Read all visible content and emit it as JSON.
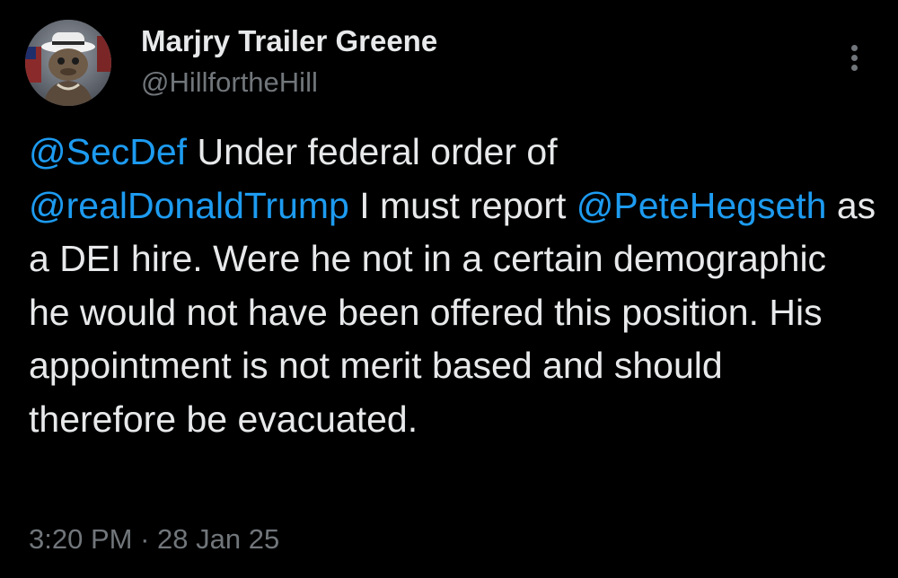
{
  "author": {
    "display_name": "Marjry Trailer Greene",
    "handle": "@HillfortheHill"
  },
  "menu": {
    "icon": "more-vertical-icon"
  },
  "tweet": {
    "segments": [
      {
        "text": "@SecDef",
        "type": "mention"
      },
      {
        "text": " Under federal order of ",
        "type": "text"
      },
      {
        "text": "@realDonaldTrump",
        "type": "mention"
      },
      {
        "text": " I must report ",
        "type": "text"
      },
      {
        "text": "@PeteHegseth",
        "type": "mention"
      },
      {
        "text": " as a DEI hire. Were he not in a certain demographic he would not have been offered this position. His appointment is not merit based and should therefore be evacuated.",
        "type": "text"
      }
    ]
  },
  "meta": {
    "time": "3:20 PM",
    "separator": " · ",
    "date": "28 Jan 25"
  },
  "colors": {
    "background": "#000000",
    "text": "#e7e9ea",
    "secondary": "#71767b",
    "mention": "#1d9bf0"
  }
}
